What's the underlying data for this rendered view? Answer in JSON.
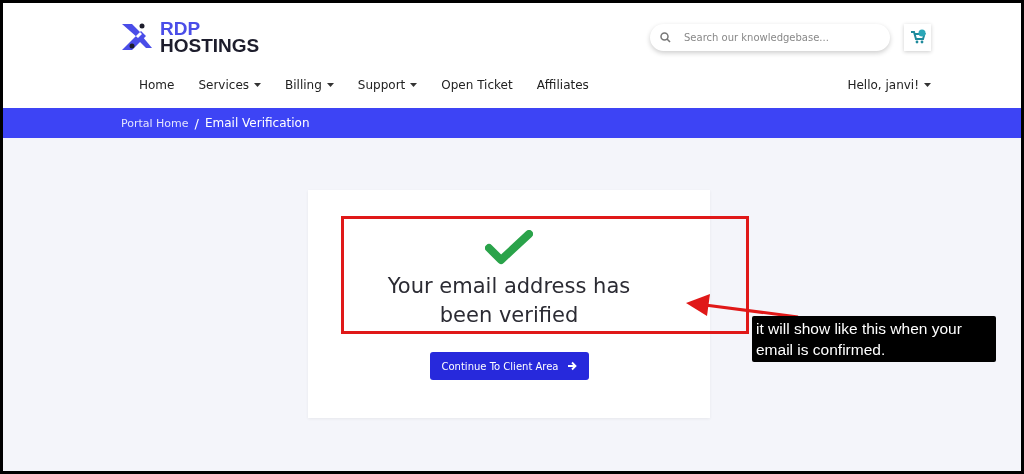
{
  "logo": {
    "line_1": "RDP",
    "line_2": "HOSTINGS"
  },
  "search": {
    "placeholder": "Search our knowledgebase..."
  },
  "nav": [
    {
      "label": "Home",
      "has_menu": false
    },
    {
      "label": "Services",
      "has_menu": true
    },
    {
      "label": "Billing",
      "has_menu": true
    },
    {
      "label": "Support",
      "has_menu": true
    },
    {
      "label": "Open Ticket",
      "has_menu": false
    },
    {
      "label": "Affiliates",
      "has_menu": false
    }
  ],
  "account": {
    "label": "Hello, janvi!",
    "has_menu": true
  },
  "breadcrumb": {
    "items": [
      "Portal Home",
      "Email Verification"
    ],
    "separator": "/"
  },
  "message": {
    "title": "Your email address has been verified",
    "button": "Continue To Client Area"
  },
  "annotation": {
    "note": "it will show like this when your email is confirmed."
  }
}
